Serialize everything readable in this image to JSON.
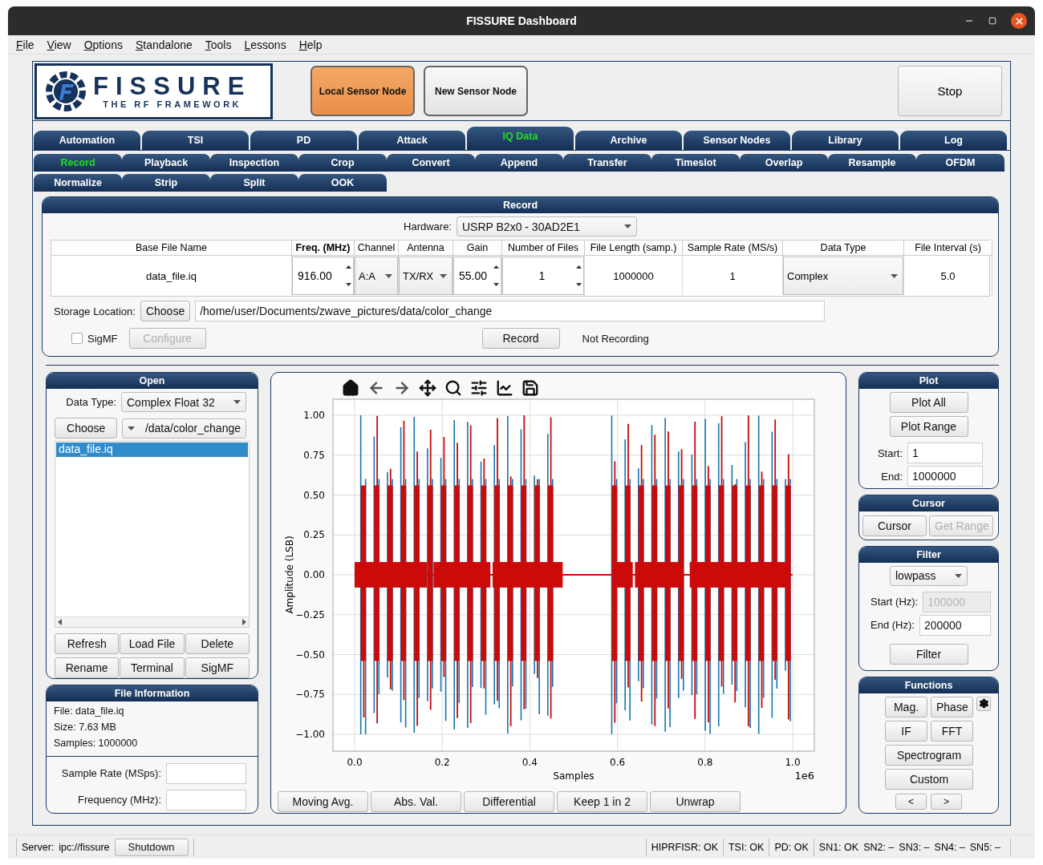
{
  "window": {
    "title": "FISSURE Dashboard"
  },
  "menu": [
    "File",
    "View",
    "Options",
    "Standalone",
    "Tools",
    "Lessons",
    "Help"
  ],
  "header": {
    "logo": {
      "title": "FISSURE",
      "subtitle": "THE RF FRAMEWORK"
    },
    "node_buttons": [
      {
        "label": "Local Sensor Node",
        "active": true
      },
      {
        "label": "New Sensor Node",
        "active": false
      }
    ],
    "stop": "Stop"
  },
  "main_tabs": [
    {
      "label": "Automation",
      "selected": false
    },
    {
      "label": "TSI",
      "selected": false
    },
    {
      "label": "PD",
      "selected": false
    },
    {
      "label": "Attack",
      "selected": false
    },
    {
      "label": "IQ Data",
      "selected": true
    },
    {
      "label": "Archive",
      "selected": false
    },
    {
      "label": "Sensor Nodes",
      "selected": false
    },
    {
      "label": "Library",
      "selected": false
    },
    {
      "label": "Log",
      "selected": false
    }
  ],
  "sub_tabs": [
    {
      "label": "Record",
      "selected": true
    },
    {
      "label": "Playback",
      "selected": false
    },
    {
      "label": "Inspection",
      "selected": false
    },
    {
      "label": "Crop",
      "selected": false
    },
    {
      "label": "Convert",
      "selected": false
    },
    {
      "label": "Append",
      "selected": false
    },
    {
      "label": "Transfer",
      "selected": false
    },
    {
      "label": "Timeslot",
      "selected": false
    },
    {
      "label": "Overlap",
      "selected": false
    },
    {
      "label": "Resample",
      "selected": false
    },
    {
      "label": "OFDM",
      "selected": false
    },
    {
      "label": "Normalize",
      "selected": false
    },
    {
      "label": "Strip",
      "selected": false
    },
    {
      "label": "Split",
      "selected": false
    },
    {
      "label": "OOK",
      "selected": false
    }
  ],
  "record": {
    "title": "Record",
    "hardware_label": "Hardware:",
    "hardware": "USRP B2x0 - 30AD2E1",
    "columns": [
      {
        "label": "Base File Name",
        "bold": false
      },
      {
        "label": "Freq. (MHz)",
        "bold": true
      },
      {
        "label": "Channel",
        "bold": false
      },
      {
        "label": "Antenna",
        "bold": false
      },
      {
        "label": "Gain",
        "bold": false
      },
      {
        "label": "Number of Files",
        "bold": false
      },
      {
        "label": "File Length (samp.)",
        "bold": false
      },
      {
        "label": "Sample Rate (MS/s)",
        "bold": false
      },
      {
        "label": "Data Type",
        "bold": false
      },
      {
        "label": "File Interval (s)",
        "bold": false
      }
    ],
    "cells": [
      {
        "kind": "text",
        "value": "data_file.iq"
      },
      {
        "kind": "spin",
        "value": "916.00"
      },
      {
        "kind": "combo",
        "value": "A:A"
      },
      {
        "kind": "combo",
        "value": "TX/RX"
      },
      {
        "kind": "spin",
        "value": "55.00"
      },
      {
        "kind": "spin",
        "value": "1"
      },
      {
        "kind": "text",
        "value": "1000000"
      },
      {
        "kind": "text",
        "value": "1"
      },
      {
        "kind": "combo",
        "value": "Complex"
      },
      {
        "kind": "text",
        "value": "5.0"
      }
    ],
    "storage_label": "Storage Location:",
    "choose": "Choose",
    "storage_path": "/home/user/Documents/zwave_pictures/data/color_change",
    "sigmf": {
      "label": "SigMF",
      "checked": false
    },
    "configure": {
      "label": "Configure",
      "disabled": true
    },
    "record_button": "Record",
    "status": "Not Recording"
  },
  "open": {
    "title": "Open",
    "data_type_label": "Data Type:",
    "data_type": "Complex Float 32",
    "choose": "Choose",
    "folder": "/data/color_change",
    "files": [
      {
        "name": "data_file.iq",
        "selected": true
      }
    ],
    "buttons": [
      "Refresh",
      "Load File",
      "Delete",
      "Rename",
      "Terminal",
      "SigMF"
    ]
  },
  "file_info": {
    "title": "File Information",
    "lines": [
      "File: data_file.iq",
      "Size: 7.63 MB",
      "Samples: 1000000"
    ],
    "fields": [
      "Sample Rate (MSps):",
      "Frequency (MHz):"
    ]
  },
  "plot": {
    "ylabel": "Amplitude (LSB)",
    "xlabel": "Samples",
    "x_offset": "1e6",
    "y_ticks": [
      "1.00",
      "0.75",
      "0.50",
      "0.25",
      "0.00",
      "−0.25",
      "−0.50",
      "−0.75",
      "−1.00"
    ],
    "x_ticks": [
      "0.0",
      "0.2",
      "0.4",
      "0.6",
      "0.8",
      "1.0"
    ],
    "buttons": [
      "Moving Avg.",
      "Abs. Val.",
      "Differential",
      "Keep 1 in 2",
      "Unwrap"
    ]
  },
  "plot_panel": {
    "title": "Plot",
    "buttons": [
      "Plot All",
      "Plot Range"
    ],
    "fields": [
      {
        "label": "Start:",
        "value": "1"
      },
      {
        "label": "End:",
        "value": "1000000"
      }
    ]
  },
  "cursor_panel": {
    "title": "Cursor",
    "buttons": [
      {
        "label": "Cursor",
        "disabled": false
      },
      {
        "label": "Get Range",
        "disabled": true
      }
    ]
  },
  "filter_panel": {
    "title": "Filter",
    "type": "lowpass",
    "fields": [
      {
        "label": "Start (Hz):",
        "value": "100000",
        "disabled": true
      },
      {
        "label": "End (Hz):",
        "value": "200000",
        "disabled": false
      }
    ],
    "button": "Filter"
  },
  "functions_panel": {
    "title": "Functions",
    "buttons": [
      "Mag.",
      "Phase",
      "IF",
      "FFT",
      "Spectrogram",
      "Custom"
    ],
    "nav": [
      "<",
      ">"
    ]
  },
  "status_bar": {
    "server_label": "Server:",
    "server": "ipc://fissure",
    "shutdown": "Shutdown",
    "statuses": [
      "HIPRFISR: OK",
      "TSI: OK",
      "PD: OK"
    ],
    "nodes": [
      "SN1: OK",
      "SN2: –",
      "SN3: –",
      "SN4: –",
      "SN5: –"
    ]
  }
}
